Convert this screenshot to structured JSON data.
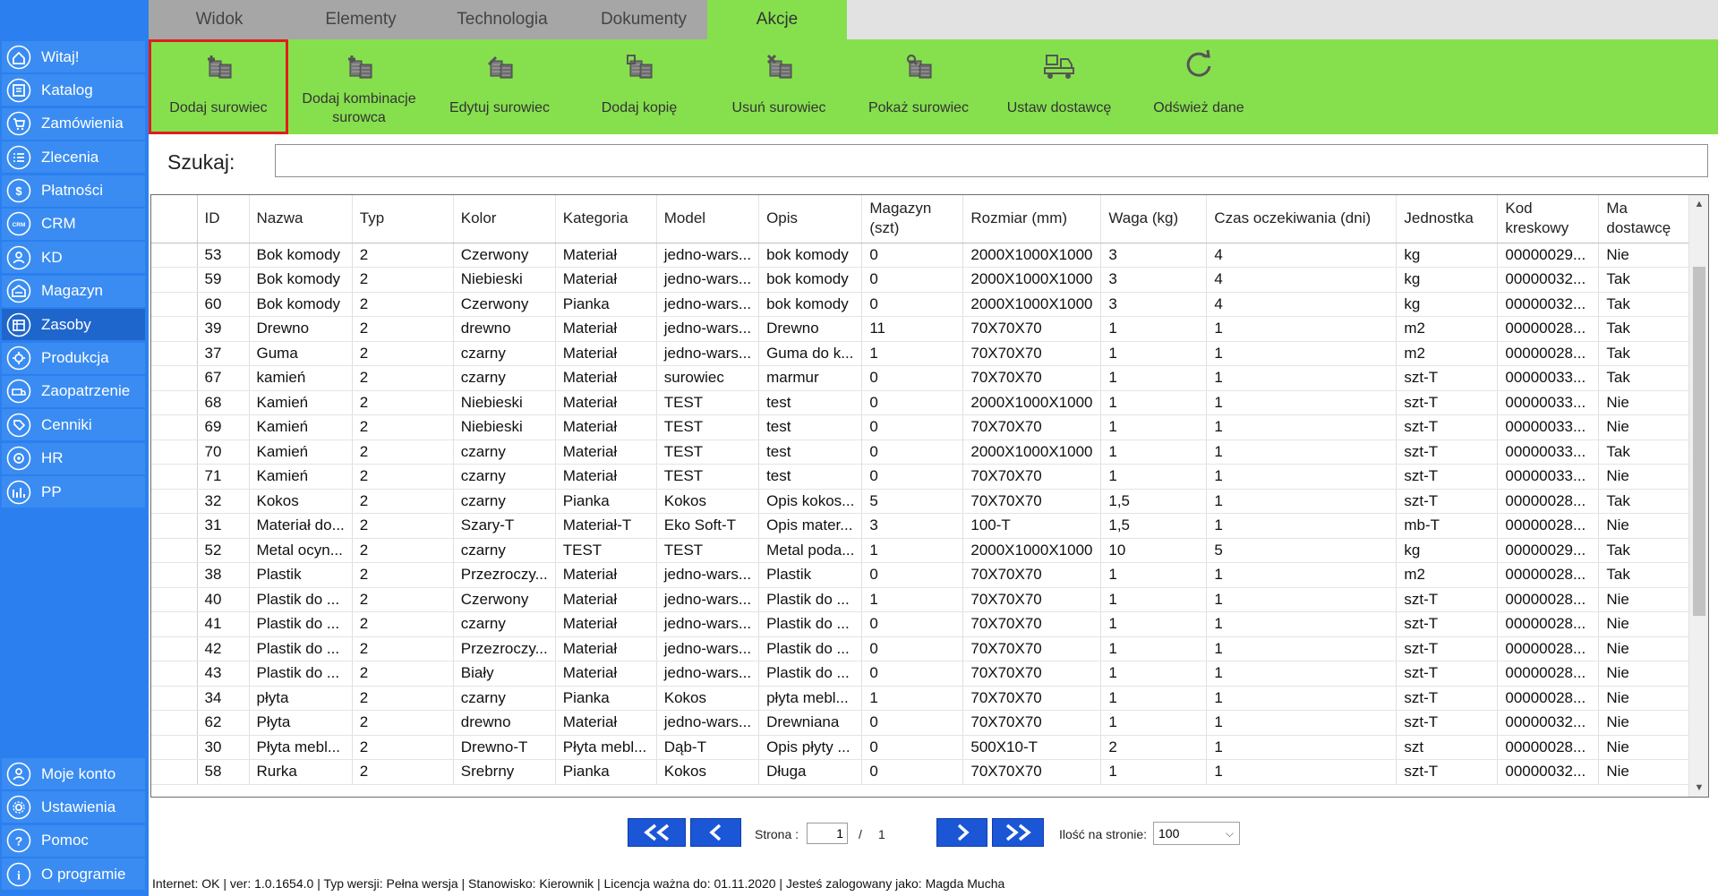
{
  "tabs": [
    {
      "label": "Widok",
      "active": false
    },
    {
      "label": "Elementy",
      "active": false
    },
    {
      "label": "Technologia",
      "active": false
    },
    {
      "label": "Dokumenty",
      "active": false
    },
    {
      "label": "Akcje",
      "active": true
    }
  ],
  "sidebar": {
    "items": [
      {
        "label": "Witaj!",
        "icon": "home-icon"
      },
      {
        "label": "Katalog",
        "icon": "catalog-icon"
      },
      {
        "label": "Zamówienia",
        "icon": "cart-icon"
      },
      {
        "label": "Zlecenia",
        "icon": "list-icon"
      },
      {
        "label": "Płatności",
        "icon": "dollar-icon"
      },
      {
        "label": "CRM",
        "icon": "crm-icon"
      },
      {
        "label": "KD",
        "icon": "user-icon"
      },
      {
        "label": "Magazyn",
        "icon": "warehouse-icon"
      },
      {
        "label": "Zasoby",
        "icon": "resources-icon",
        "active": true
      },
      {
        "label": "Produkcja",
        "icon": "production-icon"
      },
      {
        "label": "Zaopatrzenie",
        "icon": "supply-icon"
      },
      {
        "label": "Cenniki",
        "icon": "tag-icon"
      },
      {
        "label": "HR",
        "icon": "hr-icon"
      },
      {
        "label": "PP",
        "icon": "chart-icon"
      }
    ],
    "bottom_items": [
      {
        "label": "Moje konto",
        "icon": "user-icon"
      },
      {
        "label": "Ustawienia",
        "icon": "gear-icon"
      },
      {
        "label": "Pomoc",
        "icon": "question-icon"
      },
      {
        "label": "O programie",
        "icon": "info-icon"
      }
    ]
  },
  "ribbon": {
    "buttons": [
      {
        "label": "Dodaj surowiec",
        "name": "add-material-button",
        "icon": "add-material-icon",
        "selected": true
      },
      {
        "label": "Dodaj kombinacje surowca",
        "name": "add-material-combination-button",
        "icon": "add-combination-icon"
      },
      {
        "label": "Edytuj surowiec",
        "name": "edit-material-button",
        "icon": "edit-material-icon"
      },
      {
        "label": "Dodaj kopię",
        "name": "add-copy-button",
        "icon": "copy-material-icon"
      },
      {
        "label": "Usuń surowiec",
        "name": "delete-material-button",
        "icon": "delete-material-icon"
      },
      {
        "label": "Pokaż surowiec",
        "name": "show-material-button",
        "icon": "show-material-icon"
      },
      {
        "label": "Ustaw dostawcę",
        "name": "set-supplier-button",
        "icon": "truck-icon"
      },
      {
        "label": "Odśwież dane",
        "name": "refresh-button",
        "icon": "refresh-icon"
      }
    ]
  },
  "search": {
    "label": "Szukaj:",
    "value": "",
    "placeholder": ""
  },
  "table": {
    "columns": [
      "ID",
      "Nazwa",
      "Typ",
      "Kolor",
      "Kategoria",
      "Model",
      "Opis",
      "Magazyn (szt)",
      "Rozmiar (mm)",
      "Waga (kg)",
      "Czas oczekiwania (dni)",
      "Jednostka",
      "Kod kreskowy",
      "Ma dostawcę"
    ],
    "rows": [
      [
        "53",
        "Bok komody",
        "2",
        "Czerwony",
        "Materiał",
        "jedno-wars...",
        "bok komody",
        "0",
        "2000X1000X1000",
        "3",
        "4",
        "kg",
        "00000029...",
        "Nie"
      ],
      [
        "59",
        "Bok komody",
        "2",
        "Niebieski",
        "Materiał",
        "jedno-wars...",
        "bok komody",
        "0",
        "2000X1000X1000",
        "3",
        "4",
        "kg",
        "00000032...",
        "Tak"
      ],
      [
        "60",
        "Bok komody",
        "2",
        "Czerwony",
        "Pianka",
        "jedno-wars...",
        "bok komody",
        "0",
        "2000X1000X1000",
        "3",
        "4",
        "kg",
        "00000032...",
        "Tak"
      ],
      [
        "39",
        "Drewno",
        "2",
        "drewno",
        "Materiał",
        "jedno-wars...",
        "Drewno",
        "11",
        "70X70X70",
        "1",
        "1",
        "m2",
        "00000028...",
        "Tak"
      ],
      [
        "37",
        "Guma",
        "2",
        "czarny",
        "Materiał",
        "jedno-wars...",
        "Guma do k...",
        "1",
        "70X70X70",
        "1",
        "1",
        "m2",
        "00000028...",
        "Tak"
      ],
      [
        "67",
        "kamień",
        "2",
        "czarny",
        "Materiał",
        "surowiec",
        "marmur",
        "0",
        "70X70X70",
        "1",
        "1",
        "szt-T",
        "00000033...",
        "Tak"
      ],
      [
        "68",
        "Kamień",
        "2",
        "Niebieski",
        "Materiał",
        "TEST",
        "test",
        "0",
        "2000X1000X1000",
        "1",
        "1",
        "szt-T",
        "00000033...",
        "Nie"
      ],
      [
        "69",
        "Kamień",
        "2",
        "Niebieski",
        "Materiał",
        "TEST",
        "test",
        "0",
        "70X70X70",
        "1",
        "1",
        "szt-T",
        "00000033...",
        "Nie"
      ],
      [
        "70",
        "Kamień",
        "2",
        "czarny",
        "Materiał",
        "TEST",
        "test",
        "0",
        "2000X1000X1000",
        "1",
        "1",
        "szt-T",
        "00000033...",
        "Tak"
      ],
      [
        "71",
        "Kamień",
        "2",
        "czarny",
        "Materiał",
        "TEST",
        "test",
        "0",
        "70X70X70",
        "1",
        "1",
        "szt-T",
        "00000033...",
        "Nie"
      ],
      [
        "32",
        "Kokos",
        "2",
        "czarny",
        "Pianka",
        "Kokos",
        "Opis kokos...",
        "5",
        "70X70X70",
        "1,5",
        "1",
        "szt-T",
        "00000028...",
        "Tak"
      ],
      [
        "31",
        "Materiał do...",
        "2",
        "Szary-T",
        "Materiał-T",
        "Eko Soft-T",
        "Opis mater...",
        "3",
        "100-T",
        "1,5",
        "1",
        "mb-T",
        "00000028...",
        "Nie"
      ],
      [
        "52",
        "Metal ocyn...",
        "2",
        "czarny",
        "TEST",
        "TEST",
        "Metal poda...",
        "1",
        "2000X1000X1000",
        "10",
        "5",
        "kg",
        "00000029...",
        "Tak"
      ],
      [
        "38",
        "Plastik",
        "2",
        "Przezroczy...",
        "Materiał",
        "jedno-wars...",
        "Plastik",
        "0",
        "70X70X70",
        "1",
        "1",
        "m2",
        "00000028...",
        "Tak"
      ],
      [
        "40",
        "Plastik do ...",
        "2",
        "Czerwony",
        "Materiał",
        "jedno-wars...",
        "Plastik do ...",
        "1",
        "70X70X70",
        "1",
        "1",
        "szt-T",
        "00000028...",
        "Nie"
      ],
      [
        "41",
        "Plastik do ...",
        "2",
        "czarny",
        "Materiał",
        "jedno-wars...",
        "Plastik do ...",
        "0",
        "70X70X70",
        "1",
        "1",
        "szt-T",
        "00000028...",
        "Nie"
      ],
      [
        "42",
        "Plastik do ...",
        "2",
        "Przezroczy...",
        "Materiał",
        "jedno-wars...",
        "Plastik do ...",
        "0",
        "70X70X70",
        "1",
        "1",
        "szt-T",
        "00000028...",
        "Nie"
      ],
      [
        "43",
        "Plastik do ...",
        "2",
        "Biały",
        "Materiał",
        "jedno-wars...",
        "Plastik do ...",
        "0",
        "70X70X70",
        "1",
        "1",
        "szt-T",
        "00000028...",
        "Nie"
      ],
      [
        "34",
        "płyta",
        "2",
        "czarny",
        "Pianka",
        "Kokos",
        "płyta mebl...",
        "1",
        "70X70X70",
        "1",
        "1",
        "szt-T",
        "00000028...",
        "Nie"
      ],
      [
        "62",
        "Płyta",
        "2",
        "drewno",
        "Materiał",
        "jedno-wars...",
        "Drewniana",
        "0",
        "70X70X70",
        "1",
        "1",
        "szt-T",
        "00000032...",
        "Nie"
      ],
      [
        "30",
        "Płyta mebl...",
        "2",
        "Drewno-T",
        "Płyta mebl...",
        "Dąb-T",
        "Opis płyty ...",
        "0",
        "500X10-T",
        "2",
        "1",
        "szt",
        "00000028...",
        "Nie"
      ],
      [
        "58",
        "Rurka",
        "2",
        "Srebrny",
        "Pianka",
        "Kokos",
        "Długa",
        "0",
        "70X70X70",
        "1",
        "1",
        "szt-T",
        "00000032...",
        "Nie"
      ]
    ]
  },
  "pager": {
    "page_label": "Strona :",
    "current_page": "1",
    "separator": "/",
    "total_pages": "1",
    "per_page_label": "Ilość na stronie:",
    "per_page_value": "100"
  },
  "status": {
    "text": "Internet: OK  |   ver: 1.0.1654.0   |   Typ wersji: Pełna wersja   |   Stanowisko: Kierownik   |   Licencja ważna do: 01.11.2020   |   Jesteś zalogowany jako: Magda Mucha"
  },
  "colors": {
    "sidebar": "#2b7fee",
    "ribbon": "#86e04e",
    "pager_button": "#1a56d6",
    "selected_outline": "#e01d1d"
  }
}
